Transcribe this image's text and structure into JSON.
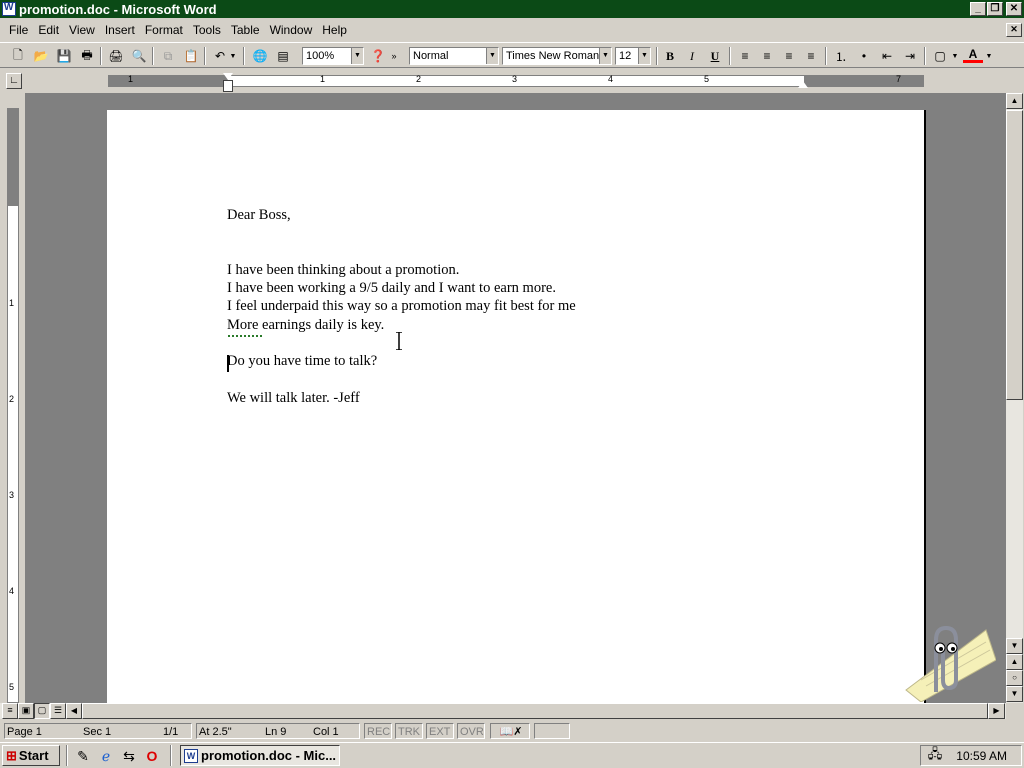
{
  "window": {
    "title": "promotion.doc - Microsoft Word",
    "min": "_",
    "restore": "❐",
    "close": "✕"
  },
  "menu": [
    "File",
    "Edit",
    "View",
    "Insert",
    "Format",
    "Tools",
    "Table",
    "Window",
    "Help"
  ],
  "toolbar": {
    "zoom": "100%",
    "style": "Normal",
    "font": "Times New Roman",
    "size": "12",
    "bold": "B",
    "italic": "I",
    "underline": "U",
    "font_color_letter": "A",
    "font_color": "#ff0000"
  },
  "ruler": {
    "h_numbers": [
      "1",
      "1",
      "2",
      "3",
      "4",
      "5",
      "7"
    ],
    "v_numbers": [
      "1",
      "2",
      "3",
      "4",
      "5"
    ]
  },
  "document": {
    "lines": [
      "Dear Boss,",
      "",
      "",
      "I have been thinking about a promotion.",
      "I have been working a 9/5 daily and I want to earn more.",
      "I feel underpaid this way so a promotion may fit best for me",
      "More earnings daily is key.",
      "",
      "Do you have time to talk?",
      "",
      "We will talk later. -Jeff"
    ]
  },
  "status": {
    "page": "Page 1",
    "sec": "Sec 1",
    "pages": "1/1",
    "at": "At 2.5\"",
    "ln": "Ln 9",
    "col": "Col 1",
    "rec": "REC",
    "trk": "TRK",
    "ext": "EXT",
    "ovr": "OVR"
  },
  "taskbar": {
    "start": "Start",
    "task": "promotion.doc - Mic...",
    "clock": "10:59 AM"
  },
  "colors": {
    "titlebar": "#0b4a16",
    "face": "#d4d0c8",
    "workspace": "#808080"
  }
}
